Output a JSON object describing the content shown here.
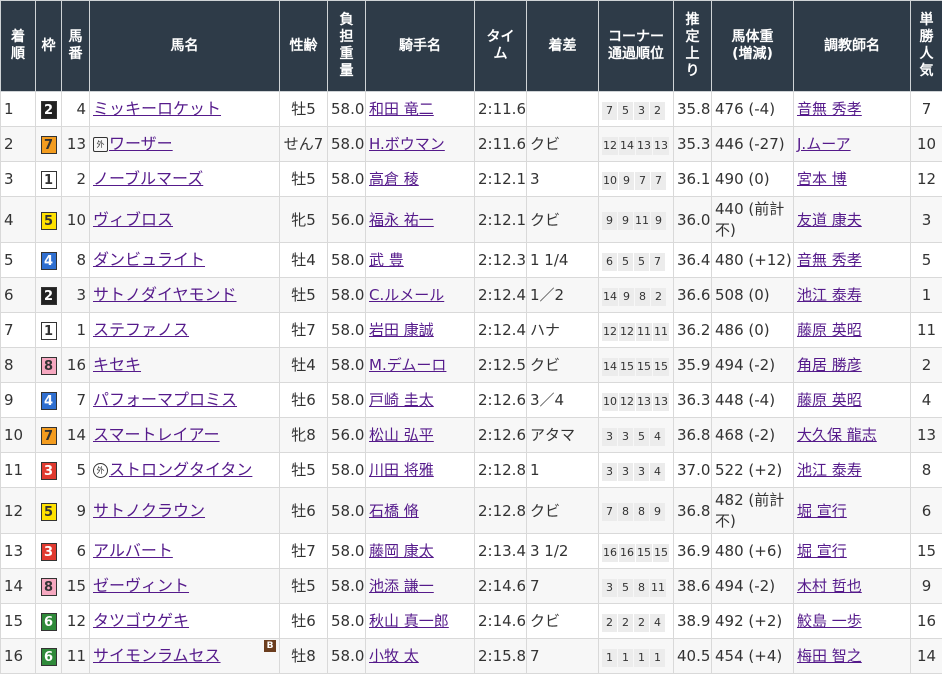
{
  "colors": {
    "header_bg": "#2e3b48",
    "link": "#551a8b",
    "waku": {
      "1": {
        "bg": "#ffffff",
        "fg": "#333333"
      },
      "2": {
        "bg": "#222222",
        "fg": "#ffffff"
      },
      "3": {
        "bg": "#e03a2f",
        "fg": "#ffffff"
      },
      "4": {
        "bg": "#2f6fd0",
        "fg": "#ffffff"
      },
      "5": {
        "bg": "#ffe100",
        "fg": "#333333"
      },
      "6": {
        "bg": "#2f8a3a",
        "fg": "#ffffff"
      },
      "7": {
        "bg": "#f39c1f",
        "fg": "#333333"
      },
      "8": {
        "bg": "#f6a8c0",
        "fg": "#333333"
      }
    }
  },
  "headers": {
    "rank": [
      "着",
      "順"
    ],
    "waku": [
      "枠"
    ],
    "umaban": [
      "馬",
      "番"
    ],
    "horse": [
      "馬名"
    ],
    "sexage": [
      "性齢"
    ],
    "weight": [
      "負",
      "担",
      "重",
      "量"
    ],
    "jockey": [
      "騎手名"
    ],
    "time": [
      "タイ",
      "ム"
    ],
    "margin": [
      "着差"
    ],
    "corner": [
      "コーナー",
      "通過順位"
    ],
    "last3f": [
      "推",
      "定",
      "上",
      "り"
    ],
    "bodyweight": [
      "馬体重",
      "(増減)"
    ],
    "trainer": [
      "調教師名"
    ],
    "pop": [
      "単",
      "勝",
      "人",
      "気"
    ]
  },
  "rows": [
    {
      "rank": "1",
      "waku": "2",
      "umaban": "4",
      "horse": "ミッキーロケット",
      "mark": "",
      "blinker": "",
      "sexage": "牡5",
      "weight": "58.0",
      "jockey": "和田 竜二",
      "time": "2:11.6",
      "margin": "",
      "corner": [
        "7",
        "5",
        "3",
        "2"
      ],
      "last3f": "35.8",
      "bodyweight": "476 (-4)",
      "trainer": "音無 秀孝",
      "pop": "7"
    },
    {
      "rank": "2",
      "waku": "7",
      "umaban": "13",
      "horse": "ワーザー",
      "mark": "外",
      "blinker": "",
      "sexage": "せん7",
      "weight": "58.0",
      "jockey": "H.ボウマン",
      "time": "2:11.6",
      "margin": "クビ",
      "corner": [
        "12",
        "14",
        "13",
        "13"
      ],
      "last3f": "35.3",
      "bodyweight": "446 (-27)",
      "trainer": "J.ムーア",
      "pop": "10"
    },
    {
      "rank": "3",
      "waku": "1",
      "umaban": "2",
      "horse": "ノーブルマーズ",
      "mark": "",
      "blinker": "",
      "sexage": "牡5",
      "weight": "58.0",
      "jockey": "高倉 稜",
      "time": "2:12.1",
      "margin": "3",
      "corner": [
        "10",
        "9",
        "7",
        "7"
      ],
      "last3f": "36.1",
      "bodyweight": "490 (0)",
      "trainer": "宮本 博",
      "pop": "12"
    },
    {
      "rank": "4",
      "waku": "5",
      "umaban": "10",
      "horse": "ヴィブロス",
      "mark": "",
      "blinker": "",
      "sexage": "牝5",
      "weight": "56.0",
      "jockey": "福永 祐一",
      "time": "2:12.1",
      "margin": "クビ",
      "corner": [
        "9",
        "9",
        "11",
        "9"
      ],
      "last3f": "36.0",
      "bodyweight": "440 (前計不)",
      "trainer": "友道 康夫",
      "pop": "3"
    },
    {
      "rank": "5",
      "waku": "4",
      "umaban": "8",
      "horse": "ダンビュライト",
      "mark": "",
      "blinker": "",
      "sexage": "牡4",
      "weight": "58.0",
      "jockey": "武 豊",
      "time": "2:12.3",
      "margin": "1 1/4",
      "corner": [
        "6",
        "5",
        "5",
        "7"
      ],
      "last3f": "36.4",
      "bodyweight": "480 (+12)",
      "trainer": "音無 秀孝",
      "pop": "5"
    },
    {
      "rank": "6",
      "waku": "2",
      "umaban": "3",
      "horse": "サトノダイヤモンド",
      "mark": "",
      "blinker": "",
      "sexage": "牡5",
      "weight": "58.0",
      "jockey": "C.ルメール",
      "time": "2:12.4",
      "margin": "1／2",
      "corner": [
        "14",
        "9",
        "8",
        "2"
      ],
      "last3f": "36.6",
      "bodyweight": "508 (0)",
      "trainer": "池江 泰寿",
      "pop": "1"
    },
    {
      "rank": "7",
      "waku": "1",
      "umaban": "1",
      "horse": "ステファノス",
      "mark": "",
      "blinker": "",
      "sexage": "牡7",
      "weight": "58.0",
      "jockey": "岩田 康誠",
      "time": "2:12.4",
      "margin": "ハナ",
      "corner": [
        "12",
        "12",
        "11",
        "11"
      ],
      "last3f": "36.2",
      "bodyweight": "486 (0)",
      "trainer": "藤原 英昭",
      "pop": "11"
    },
    {
      "rank": "8",
      "waku": "8",
      "umaban": "16",
      "horse": "キセキ",
      "mark": "",
      "blinker": "",
      "sexage": "牡4",
      "weight": "58.0",
      "jockey": "M.デムーロ",
      "time": "2:12.5",
      "margin": "クビ",
      "corner": [
        "14",
        "15",
        "15",
        "15"
      ],
      "last3f": "35.9",
      "bodyweight": "494 (-2)",
      "trainer": "角居 勝彦",
      "pop": "2"
    },
    {
      "rank": "9",
      "waku": "4",
      "umaban": "7",
      "horse": "パフォーマプロミス",
      "mark": "",
      "blinker": "",
      "sexage": "牡6",
      "weight": "58.0",
      "jockey": "戸崎 圭太",
      "time": "2:12.6",
      "margin": "3／4",
      "corner": [
        "10",
        "12",
        "13",
        "13"
      ],
      "last3f": "36.3",
      "bodyweight": "448 (-4)",
      "trainer": "藤原 英昭",
      "pop": "4"
    },
    {
      "rank": "10",
      "waku": "7",
      "umaban": "14",
      "horse": "スマートレイアー",
      "mark": "",
      "blinker": "",
      "sexage": "牝8",
      "weight": "56.0",
      "jockey": "松山 弘平",
      "time": "2:12.6",
      "margin": "アタマ",
      "corner": [
        "3",
        "3",
        "5",
        "4"
      ],
      "last3f": "36.8",
      "bodyweight": "468 (-2)",
      "trainer": "大久保 龍志",
      "pop": "13"
    },
    {
      "rank": "11",
      "waku": "3",
      "umaban": "5",
      "horse": "ストロングタイタン",
      "mark": "外",
      "blinker": "",
      "sexage": "牡5",
      "weight": "58.0",
      "jockey": "川田 将雅",
      "time": "2:12.8",
      "margin": "1",
      "corner": [
        "3",
        "3",
        "3",
        "4"
      ],
      "last3f": "37.0",
      "bodyweight": "522 (+2)",
      "trainer": "池江 泰寿",
      "pop": "8"
    },
    {
      "rank": "12",
      "waku": "5",
      "umaban": "9",
      "horse": "サトノクラウン",
      "mark": "",
      "blinker": "",
      "sexage": "牡6",
      "weight": "58.0",
      "jockey": "石橋 脩",
      "time": "2:12.8",
      "margin": "クビ",
      "corner": [
        "7",
        "8",
        "8",
        "9"
      ],
      "last3f": "36.8",
      "bodyweight": "482 (前計不)",
      "trainer": "堀 宣行",
      "pop": "6"
    },
    {
      "rank": "13",
      "waku": "3",
      "umaban": "6",
      "horse": "アルバート",
      "mark": "",
      "blinker": "",
      "sexage": "牡7",
      "weight": "58.0",
      "jockey": "藤岡 康太",
      "time": "2:13.4",
      "margin": "3 1/2",
      "corner": [
        "16",
        "16",
        "15",
        "15"
      ],
      "last3f": "36.9",
      "bodyweight": "480 (+6)",
      "trainer": "堀 宣行",
      "pop": "15"
    },
    {
      "rank": "14",
      "waku": "8",
      "umaban": "15",
      "horse": "ゼーヴィント",
      "mark": "",
      "blinker": "",
      "sexage": "牡5",
      "weight": "58.0",
      "jockey": "池添 謙一",
      "time": "2:14.6",
      "margin": "7",
      "corner": [
        "3",
        "5",
        "8",
        "11"
      ],
      "last3f": "38.6",
      "bodyweight": "494 (-2)",
      "trainer": "木村 哲也",
      "pop": "9"
    },
    {
      "rank": "15",
      "waku": "6",
      "umaban": "12",
      "horse": "タツゴウゲキ",
      "mark": "",
      "blinker": "",
      "sexage": "牡6",
      "weight": "58.0",
      "jockey": "秋山 真一郎",
      "time": "2:14.6",
      "margin": "クビ",
      "corner": [
        "2",
        "2",
        "2",
        "4"
      ],
      "last3f": "38.9",
      "bodyweight": "492 (+2)",
      "trainer": "鮫島 一歩",
      "pop": "16"
    },
    {
      "rank": "16",
      "waku": "6",
      "umaban": "11",
      "horse": "サイモンラムセス",
      "mark": "",
      "blinker": "B",
      "sexage": "牡8",
      "weight": "58.0",
      "jockey": "小牧 太",
      "time": "2:15.8",
      "margin": "7",
      "corner": [
        "1",
        "1",
        "1",
        "1"
      ],
      "last3f": "40.5",
      "bodyweight": "454 (+4)",
      "trainer": "梅田 智之",
      "pop": "14"
    }
  ]
}
